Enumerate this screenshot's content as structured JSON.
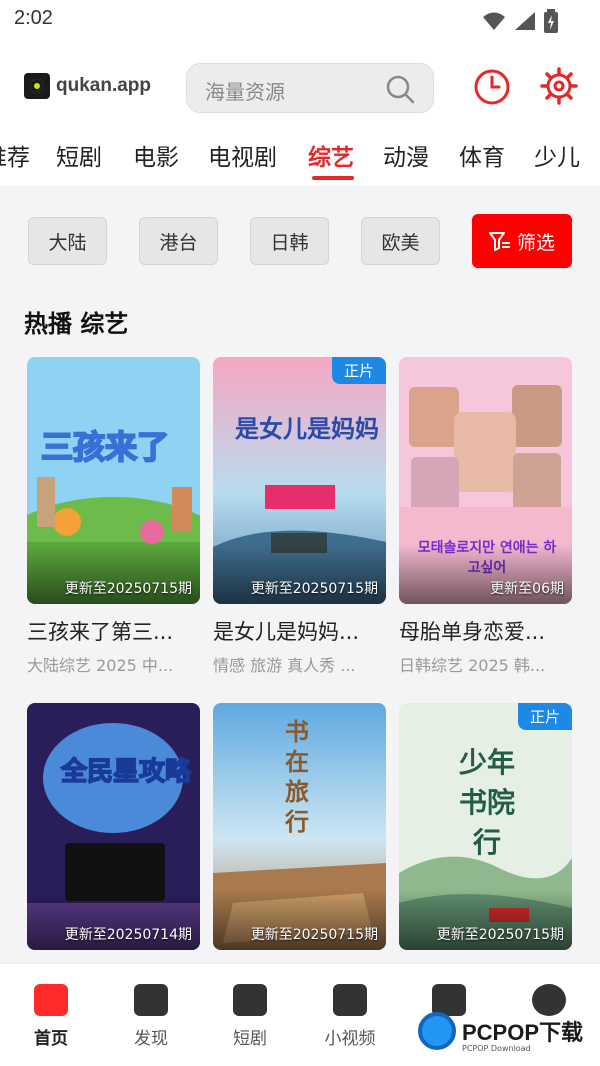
{
  "status": {
    "time": "2:02"
  },
  "header": {
    "logo_text": "qukan.app",
    "search_placeholder": "海量资源"
  },
  "tabs": [
    {
      "label": "推荐"
    },
    {
      "label": "短剧"
    },
    {
      "label": "电影"
    },
    {
      "label": "电视剧"
    },
    {
      "label": "综艺",
      "active": true
    },
    {
      "label": "动漫"
    },
    {
      "label": "体育"
    },
    {
      "label": "少儿"
    }
  ],
  "filters": {
    "regions": [
      {
        "label": "大陆"
      },
      {
        "label": "港台"
      },
      {
        "label": "日韩"
      },
      {
        "label": "欧美"
      }
    ],
    "filter_label": "筛选"
  },
  "section": {
    "title": "热播 综艺"
  },
  "cards": [
    {
      "title": "三孩来了第三...",
      "subtitle": "大陆综艺 2025 中...",
      "update": "更新至20250715期",
      "badge": "",
      "poster_text": "三孩来了"
    },
    {
      "title": "是女儿是妈妈...",
      "subtitle": "情感 旅游 真人秀 ...",
      "update": "更新至20250715期",
      "badge": "正片",
      "poster_text": "是女儿是妈妈"
    },
    {
      "title": "母胎单身恋爱...",
      "subtitle": "日韩综艺 2025 韩...",
      "update": "更新至06期",
      "badge": "",
      "poster_text": "모태솔로지만 연애는 하고싶어"
    },
    {
      "title": "",
      "subtitle": "",
      "update": "更新至20250714期",
      "badge": "",
      "poster_text": "全民星攻略"
    },
    {
      "title": "",
      "subtitle": "",
      "update": "更新至20250715期",
      "badge": "",
      "poster_text": "书在旅行"
    },
    {
      "title": "",
      "subtitle": "",
      "update": "更新至20250715期",
      "badge": "正片",
      "poster_text": "少年书院行"
    }
  ],
  "bottom_nav": [
    {
      "label": "首页",
      "icon": "clapperboard-icon",
      "active": true
    },
    {
      "label": "发现",
      "icon": "discover-icon"
    },
    {
      "label": "短剧",
      "icon": "short-drama-icon"
    },
    {
      "label": "小视频",
      "icon": "video-icon"
    },
    {
      "label": "",
      "icon": "tv-icon"
    },
    {
      "label": "",
      "icon": "profile-icon"
    }
  ],
  "watermark": {
    "text": "PCPOP下载",
    "sub": "PCPOP Download"
  },
  "colors": {
    "accent": "#e62828",
    "filter_button": "#ff0000",
    "badge": "#1e88e5"
  }
}
